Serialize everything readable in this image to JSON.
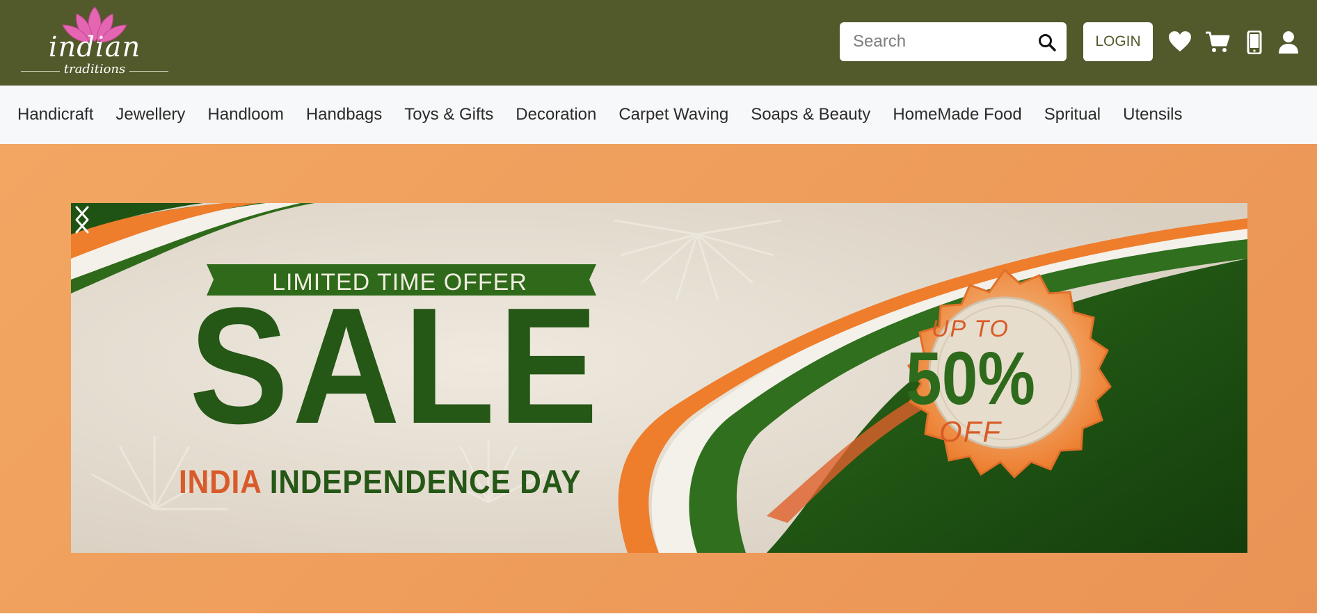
{
  "header": {
    "logo": {
      "word": "indian",
      "sub": "traditions"
    },
    "search": {
      "placeholder": "Search"
    },
    "login_label": "LOGIN",
    "icons": [
      "heart-icon",
      "cart-icon",
      "phone-icon",
      "user-icon"
    ]
  },
  "nav": {
    "items": [
      {
        "label": "Handicraft"
      },
      {
        "label": "Jewellery"
      },
      {
        "label": "Handloom"
      },
      {
        "label": "Handbags"
      },
      {
        "label": "Toys & Gifts"
      },
      {
        "label": "Decoration"
      },
      {
        "label": "Carpet Waving"
      },
      {
        "label": "Soaps & Beauty"
      },
      {
        "label": "HomeMade Food"
      },
      {
        "label": "Spritual"
      },
      {
        "label": "Utensils"
      }
    ]
  },
  "hero": {
    "banner": {
      "ribbon": "LIMITED TIME OFFER",
      "headline": "SALE",
      "occasion_a": "INDIA",
      "occasion_b": "INDEPENDENCE DAY",
      "badge_top": "UP TO",
      "badge_value": "50%",
      "badge_bottom": "OFF"
    },
    "controls": {
      "prev": "chevron-left-icon",
      "next": "chevron-right-icon"
    }
  },
  "colors": {
    "header_bg": "#52592b",
    "nav_bg": "#f7f8fa",
    "hero_bg": "#ef9d5b",
    "green": "#255716",
    "saffron": "#ee7d2c"
  }
}
